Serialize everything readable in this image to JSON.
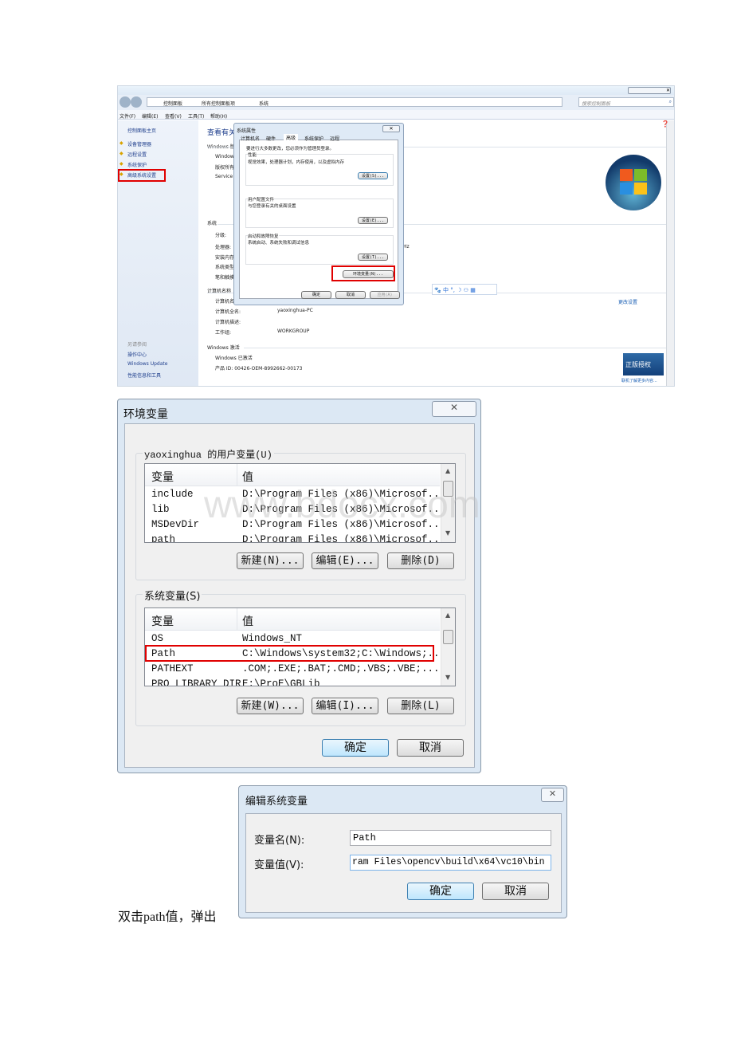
{
  "screenshot1": {
    "breadcrumb": [
      "控制面板",
      "所有控制面板项",
      "系统"
    ],
    "search_placeholder": "搜索控制面板",
    "menu": [
      "文件(F)",
      "编辑(E)",
      "查看(V)",
      "工具(T)",
      "帮助(H)"
    ],
    "sidebar": {
      "home": "控制面板主页",
      "items": [
        "设备管理器",
        "远程设置",
        "系统保护",
        "高级系统设置"
      ],
      "see_also": "另请参阅",
      "links": [
        "操作中心",
        "Windows Update",
        "性能信息和工具"
      ]
    },
    "main": {
      "heading": "查看有关",
      "windows_edition": "Windows 版",
      "edition_rows": [
        "Window",
        "版权所有",
        "Service"
      ],
      "system_section": "系统",
      "system_rows": [
        "分级:",
        "处理器:",
        "安装内存",
        "系统类型",
        "笔和触摸"
      ],
      "computer_section": "计算机名称",
      "computer_rows": [
        {
          "label": "计算机名",
          "value": ""
        },
        {
          "label": "计算机全名:",
          "value": "yaoxinghua-PC"
        },
        {
          "label": "计算机描述:",
          "value": ""
        },
        {
          "label": "工作组:",
          "value": "WORKGROUP"
        }
      ],
      "activation_section": "Windows 激活",
      "activated": "Windows 已激活",
      "product_id": "产品 ID: 00426-OEM-8992662-00173",
      "change_settings": "更改设置",
      "genuine_badge": "正版授权",
      "genuine_link": "联机了解更多内容...",
      "freq_fragment": "Hz"
    },
    "ime_bar": [
      "中"
    ],
    "dialog": {
      "title": "系统属性",
      "tabs": [
        "计算机名",
        "硬件",
        "高级",
        "系统保护",
        "远程"
      ],
      "active_tab": 2,
      "admin_note": "要进行大多数更改，您必须作为管理员登录。",
      "groups": [
        {
          "title": "性能",
          "desc": "视觉效果，处理器计划，内存使用，以及虚拟内存",
          "button": "设置(S)..."
        },
        {
          "title": "用户配置文件",
          "desc": "与您登录有关的桌面设置",
          "button": "设置(E)..."
        },
        {
          "title": "启动和故障恢复",
          "desc": "系统启动、系统失败和调试信息",
          "button": "设置(T)..."
        }
      ],
      "env_button": "环境变量(N)...",
      "ok": "确定",
      "cancel": "取消",
      "apply": "应用(A)"
    }
  },
  "screenshot2": {
    "title": "环境变量",
    "user_group": "yaoxinghua 的用户变量(U)",
    "columns": [
      "变量",
      "值"
    ],
    "user_vars": [
      [
        "include",
        "D:\\Program Files (x86)\\Microsof..."
      ],
      [
        "lib",
        "D:\\Program Files (x86)\\Microsof..."
      ],
      [
        "MSDevDir",
        "D:\\Program Files (x86)\\Microsof..."
      ],
      [
        "path",
        "D:\\Program Files (x86)\\Microsof..."
      ]
    ],
    "user_buttons": [
      "新建(N)...",
      "编辑(E)...",
      "删除(D)"
    ],
    "system_group": "系统变量(S)",
    "system_vars": [
      [
        "OS",
        "Windows_NT"
      ],
      [
        "Path",
        "C:\\Windows\\system32;C:\\Windows;..."
      ],
      [
        "PATHEXT",
        ".COM;.EXE;.BAT;.CMD;.VBS;.VBE;...."
      ],
      [
        "PRO_LIBRARY_DIR",
        "E:\\ProE\\GBLib"
      ]
    ],
    "system_buttons": [
      "新建(W)...",
      "编辑(I)...",
      "删除(L)"
    ],
    "ok": "确定",
    "cancel": "取消",
    "watermark": "www.bdocx.com"
  },
  "screenshot3": {
    "title": "编辑系统变量",
    "name_label": "变量名(N):",
    "name_value": "Path",
    "value_label": "变量值(V):",
    "value_value": "ram Files\\opencv\\build\\x64\\vc10\\bin",
    "ok": "确定",
    "cancel": "取消"
  },
  "caption": "双击path值，弹出",
  "colors": {
    "highlight": "#e00000",
    "link": "#1a5fb4",
    "heading": "#1e3e8c"
  }
}
